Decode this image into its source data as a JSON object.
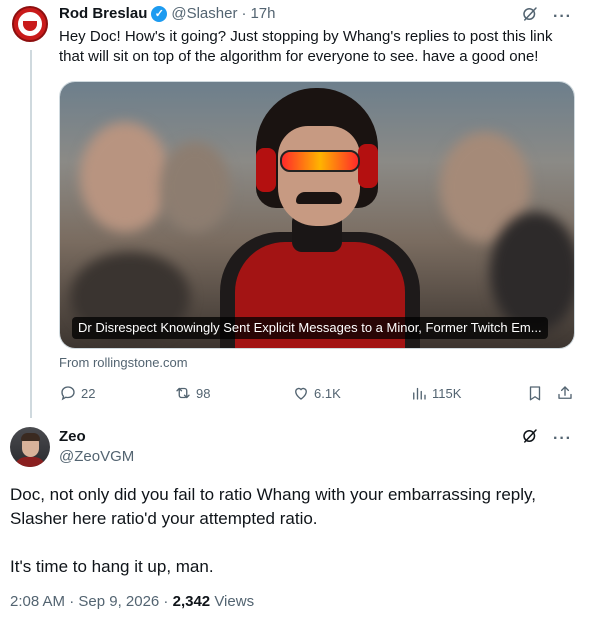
{
  "tweet1": {
    "name": "Rod Breslau",
    "handle": "@Slasher",
    "separator": "·",
    "time": "17h",
    "text": "Hey Doc! How's it going? Just stopping by Whang's replies to post this link that will sit on top of the algorithm for everyone to see. have a good one!",
    "card": {
      "caption": "Dr Disrespect Knowingly Sent Explicit Messages to a Minor, Former Twitch Em...",
      "source": "From rollingstone.com"
    },
    "actions": {
      "replies": "22",
      "reposts": "98",
      "likes": "6.1K",
      "views": "115K"
    },
    "icons": {
      "verified": "verified-badge-icon",
      "grok": "grok-icon",
      "more": "more-icon",
      "reply": "reply-icon",
      "repost": "repost-icon",
      "like": "heart-icon",
      "views": "views-chart-icon",
      "bookmark": "bookmark-icon",
      "share": "share-icon"
    }
  },
  "tweet2": {
    "name": "Zeo",
    "handle": "@ZeoVGM",
    "paragraphs": [
      "Doc, not only did you fail to ratio Whang with your embarrassing reply, Slasher here ratio'd your attempted ratio.",
      "It's time to hang it up, man."
    ],
    "timestamp": "2:08 AM · Sep 9, 2026 · ",
    "views_count": "2,342",
    "views_label": " Views"
  },
  "colors": {
    "text": "#0f1419",
    "secondary": "#536471",
    "accent": "#1d9bf0",
    "thread_line": "#cfd9de"
  }
}
